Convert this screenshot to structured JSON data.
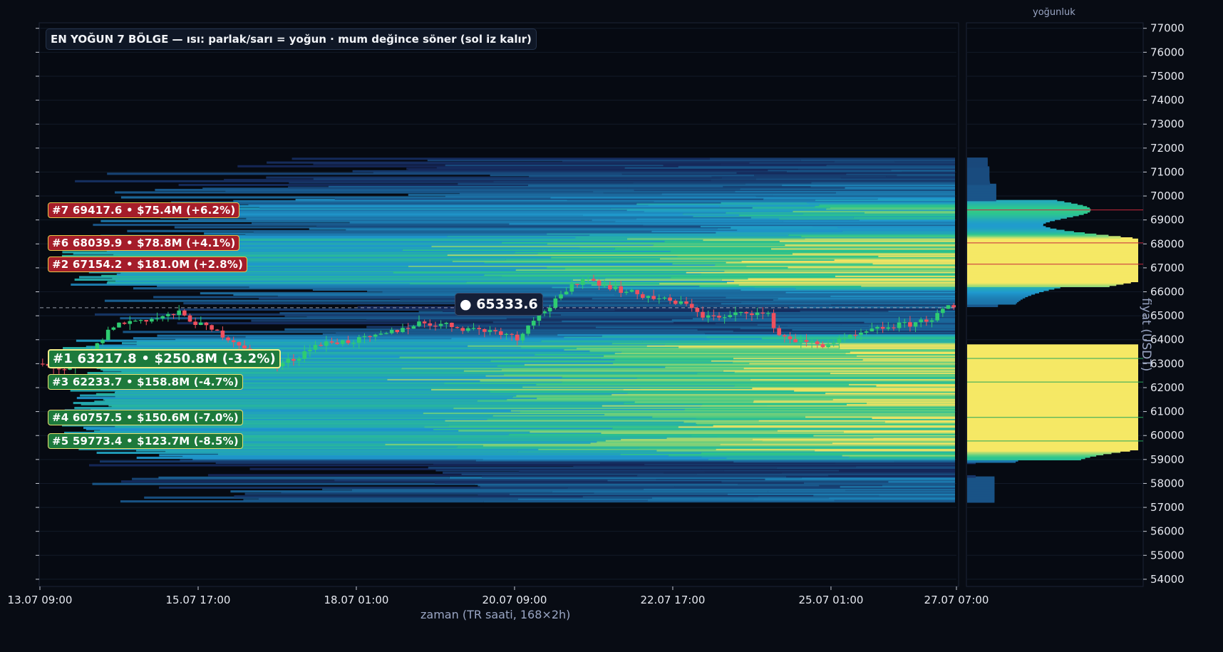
{
  "title": "EN YOĞUN 7 BÖLGE — ısı: parlak/sarı = yoğun · mum değince söner (sol iz kalır)",
  "current_price_label": "● 65333.6",
  "profile_title": "yoğunluk",
  "colors": {
    "background": "#080c14",
    "bull": "#2ecc71",
    "bear": "#f0505e",
    "heat_low": "#16285a",
    "heat_mid": "#1f9ad0",
    "heat_high": "#f5e865",
    "support_line": "#27a65a",
    "resistance_line": "#c8283c"
  },
  "chart_data": {
    "type": "heatmap",
    "title": "EN YOĞUN 7 BÖLGE — ısı: parlak/sarı = yoğun · mum değince söner (sol iz kalır)",
    "xlabel": "zaman (TR saati, 168×2h)",
    "ylabel": "fiyat (USDT)",
    "ylim": [
      53700,
      77200
    ],
    "y_ticks": [
      "54000",
      "55000",
      "56000",
      "57000",
      "58000",
      "59000",
      "60000",
      "61000",
      "62000",
      "63000",
      "64000",
      "65000",
      "66000",
      "67000",
      "68000",
      "69000",
      "70000",
      "71000",
      "72000",
      "73000",
      "74000",
      "75000",
      "76000",
      "77000"
    ],
    "x_ticks": [
      "13.07 09:00",
      "15.07 17:00",
      "18.07 01:00",
      "20.07 09:00",
      "22.07 17:00",
      "25.07 01:00",
      "27.07 07:00"
    ],
    "current_price": 65333.6,
    "levels": [
      {
        "label": "#7  69417.6  •  $75.4M  (+6.2%)",
        "price": 69417.6,
        "side": "resistance",
        "rank": 7
      },
      {
        "label": "#6  68039.9  •  $78.8M  (+4.1%)",
        "price": 68039.9,
        "side": "resistance",
        "rank": 6
      },
      {
        "label": "#2  67154.2  •  $181.0M  (+2.8%)",
        "price": 67154.2,
        "side": "resistance",
        "rank": 2
      },
      {
        "label": "#1  63217.8  •  $250.8M  (-3.2%)",
        "price": 63217.8,
        "side": "support",
        "rank": 1
      },
      {
        "label": "#3  62233.7  •  $158.8M  (-4.7%)",
        "price": 62233.7,
        "side": "support",
        "rank": 3
      },
      {
        "label": "#4  60757.5  •  $150.6M  (-7.0%)",
        "price": 60757.5,
        "side": "support",
        "rank": 4
      },
      {
        "label": "#5  59773.4  •  $123.7M  (-8.5%)",
        "price": 59773.4,
        "side": "support",
        "rank": 5
      }
    ],
    "candle_path": [
      [
        0,
        63000
      ],
      [
        6,
        62700
      ],
      [
        10,
        63500
      ],
      [
        14,
        64600
      ],
      [
        18,
        64800
      ],
      [
        22,
        64900
      ],
      [
        26,
        65100
      ],
      [
        30,
        64600
      ],
      [
        34,
        64200
      ],
      [
        38,
        63700
      ],
      [
        40,
        63200
      ],
      [
        44,
        62900
      ],
      [
        48,
        63300
      ],
      [
        50,
        63700
      ],
      [
        54,
        63900
      ],
      [
        58,
        63950
      ],
      [
        62,
        64100
      ],
      [
        66,
        64400
      ],
      [
        70,
        64700
      ],
      [
        74,
        64650
      ],
      [
        78,
        64500
      ],
      [
        82,
        64400
      ],
      [
        86,
        64300
      ],
      [
        88,
        64000
      ],
      [
        90,
        64700
      ],
      [
        94,
        65400
      ],
      [
        98,
        66200
      ],
      [
        100,
        66600
      ],
      [
        104,
        66300
      ],
      [
        108,
        66000
      ],
      [
        112,
        65800
      ],
      [
        116,
        65600
      ],
      [
        120,
        65400
      ],
      [
        122,
        65000
      ],
      [
        126,
        64900
      ],
      [
        130,
        65200
      ],
      [
        134,
        65000
      ],
      [
        136,
        64200
      ],
      [
        140,
        63900
      ],
      [
        144,
        63800
      ],
      [
        148,
        64000
      ],
      [
        152,
        64300
      ],
      [
        156,
        64550
      ],
      [
        160,
        64650
      ],
      [
        164,
        64900
      ],
      [
        167,
        65330
      ]
    ]
  }
}
